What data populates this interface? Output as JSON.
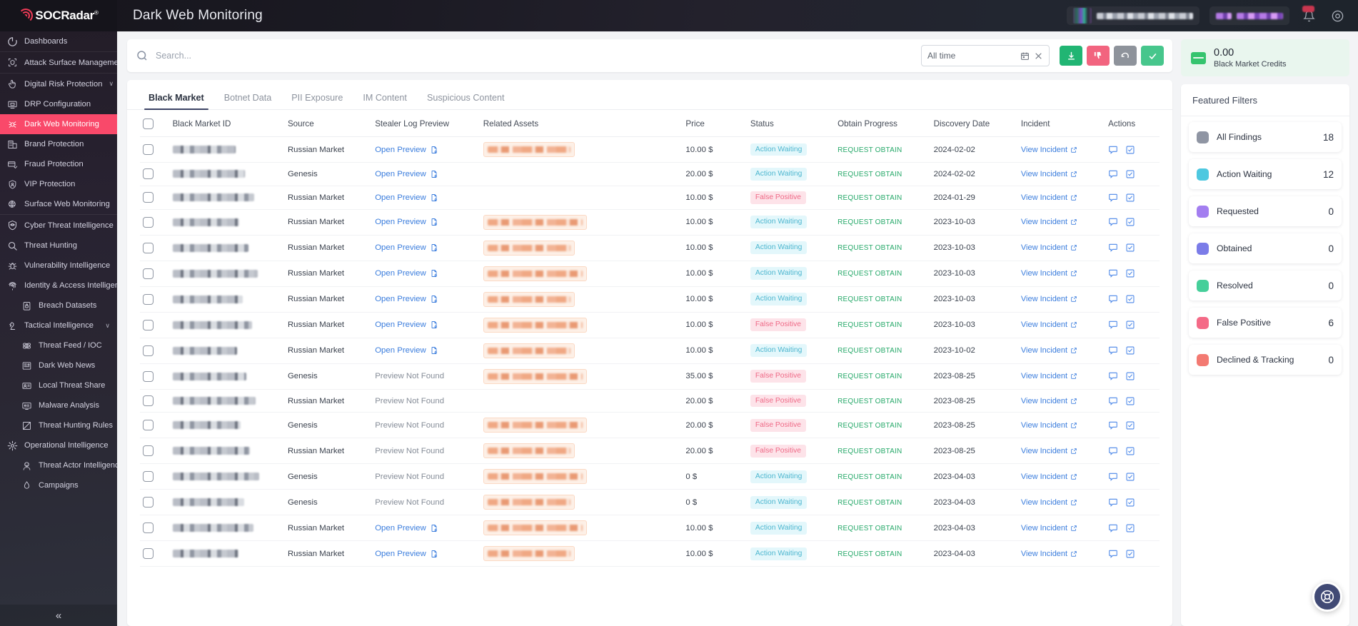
{
  "brand": {
    "name": "SOCRadar",
    "registered": "®"
  },
  "header": {
    "title": "Dark Web Monitoring",
    "widgets": [
      {
        "name": "account-widget",
        "redacted": true
      },
      {
        "name": "plan-widget",
        "redacted": true
      }
    ],
    "icons": [
      "bell-icon",
      "help-circle-icon"
    ]
  },
  "sidebar": {
    "collapse_label": "«",
    "items": [
      {
        "label": "Dashboards",
        "icon": "dashboard-icon",
        "level": "top",
        "active": false,
        "chevron": ""
      },
      {
        "label": "Attack Surface Management",
        "icon": "shield-scan-icon",
        "level": "group",
        "active": false,
        "chevron": "›"
      },
      {
        "label": "Digital Risk Protection",
        "icon": "hand-icon",
        "level": "group",
        "active": false,
        "chevron": "∨"
      },
      {
        "label": "DRP Configuration",
        "icon": "monitor-icon",
        "level": "top",
        "active": false,
        "chevron": ""
      },
      {
        "label": "Dark Web Monitoring",
        "icon": "spider-icon",
        "level": "top",
        "active": true,
        "chevron": ""
      },
      {
        "label": "Brand Protection",
        "icon": "building-icon",
        "level": "top",
        "active": false,
        "chevron": ""
      },
      {
        "label": "Fraud Protection",
        "icon": "card-fraud-icon",
        "level": "top",
        "active": false,
        "chevron": ""
      },
      {
        "label": "VIP Protection",
        "icon": "shield-person-icon",
        "level": "top",
        "active": false,
        "chevron": ""
      },
      {
        "label": "Surface Web Monitoring",
        "icon": "globe-scan-icon",
        "level": "top",
        "active": false,
        "chevron": ""
      },
      {
        "label": "Cyber Threat Intelligence",
        "icon": "shield-eye-icon",
        "level": "group",
        "active": false,
        "chevron": "∨"
      },
      {
        "label": "Threat Hunting",
        "icon": "search-icon",
        "level": "top",
        "active": false,
        "chevron": ""
      },
      {
        "label": "Vulnerability Intelligence",
        "icon": "bug-icon",
        "level": "top",
        "active": false,
        "chevron": ""
      },
      {
        "label": "Identity & Access Intelligence",
        "icon": "fingerprint-icon",
        "level": "top",
        "active": false,
        "chevron": "∨"
      },
      {
        "label": "Breach Datasets",
        "icon": "lock-db-icon",
        "level": "sub",
        "active": false,
        "chevron": ""
      },
      {
        "label": "Tactical Intelligence",
        "icon": "chess-knight-icon",
        "level": "top",
        "active": false,
        "chevron": "∨"
      },
      {
        "label": "Threat Feed / IOC",
        "icon": "atom-icon",
        "level": "sub",
        "active": false,
        "chevron": ""
      },
      {
        "label": "Dark Web News",
        "icon": "news-icon",
        "level": "sub",
        "active": false,
        "chevron": ""
      },
      {
        "label": "Local Threat Share",
        "icon": "id-card-icon",
        "level": "sub",
        "active": false,
        "chevron": ""
      },
      {
        "label": "Malware Analysis",
        "icon": "malware-icon",
        "level": "sub",
        "active": false,
        "chevron": ""
      },
      {
        "label": "Threat Hunting Rules",
        "icon": "rules-icon",
        "level": "sub",
        "active": false,
        "chevron": ""
      },
      {
        "label": "Operational Intelligence",
        "icon": "gear-star-icon",
        "level": "top",
        "active": false,
        "chevron": ""
      },
      {
        "label": "Threat Actor Intelligence",
        "icon": "actor-icon",
        "level": "sub",
        "active": false,
        "chevron": ""
      },
      {
        "label": "Campaigns",
        "icon": "campaign-icon",
        "level": "sub",
        "active": false,
        "chevron": ""
      }
    ]
  },
  "search": {
    "placeholder": "Search...",
    "value": "",
    "icon": "search-icon"
  },
  "toolbar": {
    "date_value": "All time",
    "date_icon": "calendar-icon",
    "clear_icon": "close-icon",
    "buttons": [
      {
        "name": "export-button",
        "icon": "download-icon",
        "color": "#21b573"
      },
      {
        "name": "false-positive-button",
        "icon": "thumbs-down-icon",
        "color": "#f2647f"
      },
      {
        "name": "undo-button",
        "icon": "undo-icon",
        "color": "#8e939b"
      },
      {
        "name": "resolve-button",
        "icon": "check-icon",
        "color": "#47c68c"
      }
    ]
  },
  "credits": {
    "value": "0.00",
    "label": "Black Market Credits",
    "icon": "credit-card-icon"
  },
  "tabs": [
    {
      "label": "Black Market",
      "active": true
    },
    {
      "label": "Botnet Data",
      "active": false
    },
    {
      "label": "PII Exposure",
      "active": false
    },
    {
      "label": "IM Content",
      "active": false
    },
    {
      "label": "Suspicious Content",
      "active": false
    }
  ],
  "table": {
    "columns": [
      "Black Market ID",
      "Source",
      "Stealer Log Preview",
      "Related Assets",
      "Price",
      "Status",
      "Obtain Progress",
      "Discovery Date",
      "Incident",
      "Actions"
    ],
    "link_preview": "Open Preview",
    "no_preview": "Preview Not Found",
    "incident_link": "View Incident",
    "rows": [
      {
        "id_redacted": true,
        "source": "Russian Market",
        "preview": "Open Preview",
        "has_preview": true,
        "related": true,
        "price": "10.00 $",
        "status": "Action Waiting",
        "status_type": "aw",
        "obtain": "REQUEST OBTAIN",
        "date": "2024-02-02",
        "incident": "View Incident"
      },
      {
        "id_redacted": true,
        "source": "Genesis",
        "preview": "Open Preview",
        "has_preview": true,
        "related": false,
        "price": "20.00 $",
        "status": "Action Waiting",
        "status_type": "aw",
        "obtain": "REQUEST OBTAIN",
        "date": "2024-02-02",
        "incident": "View Incident"
      },
      {
        "id_redacted": true,
        "source": "Russian Market",
        "preview": "Open Preview",
        "has_preview": true,
        "related": false,
        "price": "10.00 $",
        "status": "False Positive",
        "status_type": "fp",
        "obtain": "REQUEST OBTAIN",
        "date": "2024-01-29",
        "incident": "View Incident"
      },
      {
        "id_redacted": true,
        "source": "Russian Market",
        "preview": "Open Preview",
        "has_preview": true,
        "related": true,
        "price": "10.00 $",
        "status": "Action Waiting",
        "status_type": "aw",
        "obtain": "REQUEST OBTAIN",
        "date": "2023-10-03",
        "incident": "View Incident"
      },
      {
        "id_redacted": true,
        "source": "Russian Market",
        "preview": "Open Preview",
        "has_preview": true,
        "related": true,
        "price": "10.00 $",
        "status": "Action Waiting",
        "status_type": "aw",
        "obtain": "REQUEST OBTAIN",
        "date": "2023-10-03",
        "incident": "View Incident"
      },
      {
        "id_redacted": true,
        "source": "Russian Market",
        "preview": "Open Preview",
        "has_preview": true,
        "related": true,
        "price": "10.00 $",
        "status": "Action Waiting",
        "status_type": "aw",
        "obtain": "REQUEST OBTAIN",
        "date": "2023-10-03",
        "incident": "View Incident"
      },
      {
        "id_redacted": true,
        "source": "Russian Market",
        "preview": "Open Preview",
        "has_preview": true,
        "related": true,
        "price": "10.00 $",
        "status": "Action Waiting",
        "status_type": "aw",
        "obtain": "REQUEST OBTAIN",
        "date": "2023-10-03",
        "incident": "View Incident"
      },
      {
        "id_redacted": true,
        "source": "Russian Market",
        "preview": "Open Preview",
        "has_preview": true,
        "related": true,
        "price": "10.00 $",
        "status": "False Positive",
        "status_type": "fp",
        "obtain": "REQUEST OBTAIN",
        "date": "2023-10-03",
        "incident": "View Incident"
      },
      {
        "id_redacted": true,
        "source": "Russian Market",
        "preview": "Open Preview",
        "has_preview": true,
        "related": true,
        "price": "10.00 $",
        "status": "Action Waiting",
        "status_type": "aw",
        "obtain": "REQUEST OBTAIN",
        "date": "2023-10-02",
        "incident": "View Incident"
      },
      {
        "id_redacted": true,
        "source": "Genesis",
        "preview": "Preview Not Found",
        "has_preview": false,
        "related": true,
        "price": "35.00 $",
        "status": "False Positive",
        "status_type": "fp",
        "obtain": "REQUEST OBTAIN",
        "date": "2023-08-25",
        "incident": "View Incident"
      },
      {
        "id_redacted": true,
        "source": "Russian Market",
        "preview": "Preview Not Found",
        "has_preview": false,
        "related": false,
        "price": "20.00 $",
        "status": "False Positive",
        "status_type": "fp",
        "obtain": "REQUEST OBTAIN",
        "date": "2023-08-25",
        "incident": "View Incident"
      },
      {
        "id_redacted": true,
        "source": "Genesis",
        "preview": "Preview Not Found",
        "has_preview": false,
        "related": true,
        "price": "20.00 $",
        "status": "False Positive",
        "status_type": "fp",
        "obtain": "REQUEST OBTAIN",
        "date": "2023-08-25",
        "incident": "View Incident"
      },
      {
        "id_redacted": true,
        "source": "Russian Market",
        "preview": "Preview Not Found",
        "has_preview": false,
        "related": true,
        "price": "20.00 $",
        "status": "False Positive",
        "status_type": "fp",
        "obtain": "REQUEST OBTAIN",
        "date": "2023-08-25",
        "incident": "View Incident"
      },
      {
        "id_redacted": true,
        "source": "Genesis",
        "preview": "Preview Not Found",
        "has_preview": false,
        "related": true,
        "price": "0 $",
        "status": "Action Waiting",
        "status_type": "aw",
        "obtain": "REQUEST OBTAIN",
        "date": "2023-04-03",
        "incident": "View Incident"
      },
      {
        "id_redacted": true,
        "source": "Genesis",
        "preview": "Preview Not Found",
        "has_preview": false,
        "related": true,
        "price": "0 $",
        "status": "Action Waiting",
        "status_type": "aw",
        "obtain": "REQUEST OBTAIN",
        "date": "2023-04-03",
        "incident": "View Incident"
      },
      {
        "id_redacted": true,
        "source": "Russian Market",
        "preview": "Open Preview",
        "has_preview": true,
        "related": true,
        "price": "10.00 $",
        "status": "Action Waiting",
        "status_type": "aw",
        "obtain": "REQUEST OBTAIN",
        "date": "2023-04-03",
        "incident": "View Incident"
      },
      {
        "id_redacted": true,
        "source": "Russian Market",
        "preview": "Open Preview",
        "has_preview": true,
        "related": true,
        "price": "10.00 $",
        "status": "Action Waiting",
        "status_type": "aw",
        "obtain": "REQUEST OBTAIN",
        "date": "2023-04-03",
        "incident": "View Incident"
      }
    ]
  },
  "featured_filters": {
    "title": "Featured Filters",
    "items": [
      {
        "label": "All Findings",
        "count": "18",
        "color": "#8f95a3"
      },
      {
        "label": "Action Waiting",
        "count": "12",
        "color": "#4ec8e0"
      },
      {
        "label": "Requested",
        "count": "0",
        "color": "#a37ef0"
      },
      {
        "label": "Obtained",
        "count": "0",
        "color": "#7b7ce8"
      },
      {
        "label": "Resolved",
        "count": "0",
        "color": "#46cf9a"
      },
      {
        "label": "False Positive",
        "count": "6",
        "color": "#f46a87"
      },
      {
        "label": "Declined & Tracking",
        "count": "0",
        "color": "#f37a72"
      }
    ]
  },
  "fab": {
    "icon": "lifebuoy-icon"
  }
}
